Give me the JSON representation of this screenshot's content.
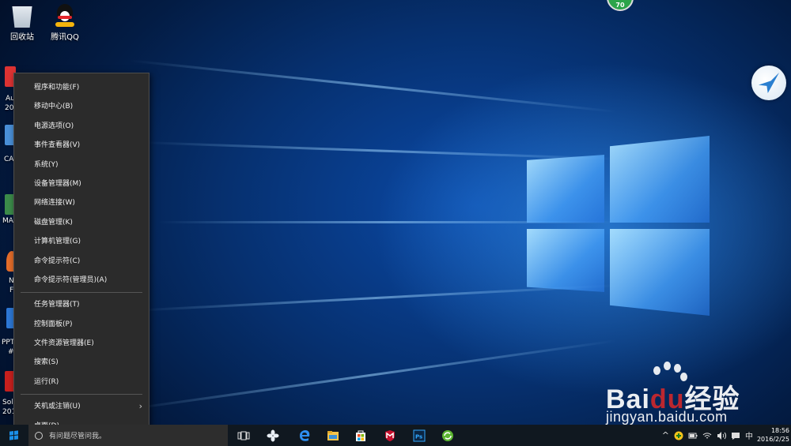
{
  "desktop": {
    "icons": [
      {
        "label": "回收站",
        "icon": "recycle-bin-icon"
      },
      {
        "label": "腾讯QQ",
        "icon": "qq-penguin-icon"
      }
    ],
    "partial_labels": [
      "Au",
      "20",
      "CA",
      "MA",
      "N",
      "F",
      "PPT",
      "#",
      "Soli",
      "201"
    ],
    "badge": "70",
    "watermark": {
      "brand_prefix": "Bai",
      "brand_middle": "du",
      "brand_suffix": "经验",
      "url": "jingyan.baidu.com"
    }
  },
  "winx_menu": {
    "group1": [
      "程序和功能(F)",
      "移动中心(B)",
      "电源选项(O)",
      "事件查看器(V)",
      "系统(Y)",
      "设备管理器(M)",
      "网络连接(W)",
      "磁盘管理(K)",
      "计算机管理(G)",
      "命令提示符(C)",
      "命令提示符(管理员)(A)"
    ],
    "group2": [
      "任务管理器(T)",
      "控制面板(P)",
      "文件资源管理器(E)",
      "搜索(S)",
      "运行(R)"
    ],
    "group3": [
      "关机或注销(U)",
      "桌面(D)"
    ],
    "submenu_arrow": "›"
  },
  "taskbar": {
    "search_placeholder": "有问题尽管问我。",
    "pinned": [
      "task-view-icon",
      "baidu-fan-icon",
      "edge-icon",
      "file-explorer-icon",
      "store-icon",
      "mcafee-icon",
      "photoshop-icon",
      "green-app-icon"
    ],
    "tray": {
      "chevron": "^",
      "ime": "中"
    },
    "time": "18:56",
    "date": "2016/2/25"
  },
  "colors": {
    "accent": "#1b8fe8",
    "menu_bg": "#2b2b2b",
    "taskbar_bg": "#101820"
  }
}
